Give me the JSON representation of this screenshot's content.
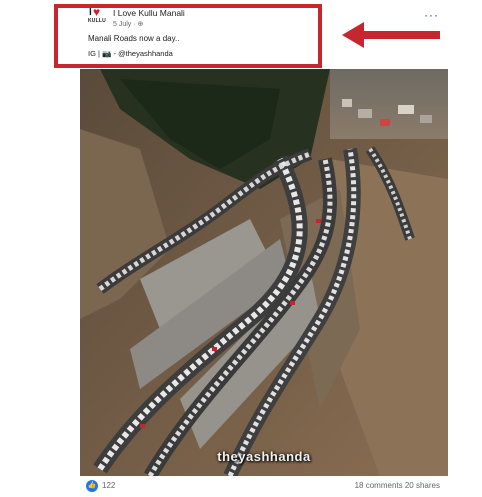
{
  "post": {
    "page_name": "I Love Kullu Manali",
    "logo_sub": "KULLU",
    "timestamp": "5 July",
    "audience_glyph": "· ⊕",
    "caption": "Manali Roads now a day..",
    "ig_prefix": "IG |",
    "ig_emoji": "📷",
    "ig_handle": " - @theyashhanda",
    "more_label": "···"
  },
  "photo": {
    "watermark": "theyashhanda"
  },
  "footer": {
    "like_glyph": "👍",
    "reaction_count": "122",
    "comments": "18 comments",
    "shares": "20 shares"
  },
  "colors": {
    "annotation_red": "#c6262e",
    "like_blue": "#1877f2"
  }
}
